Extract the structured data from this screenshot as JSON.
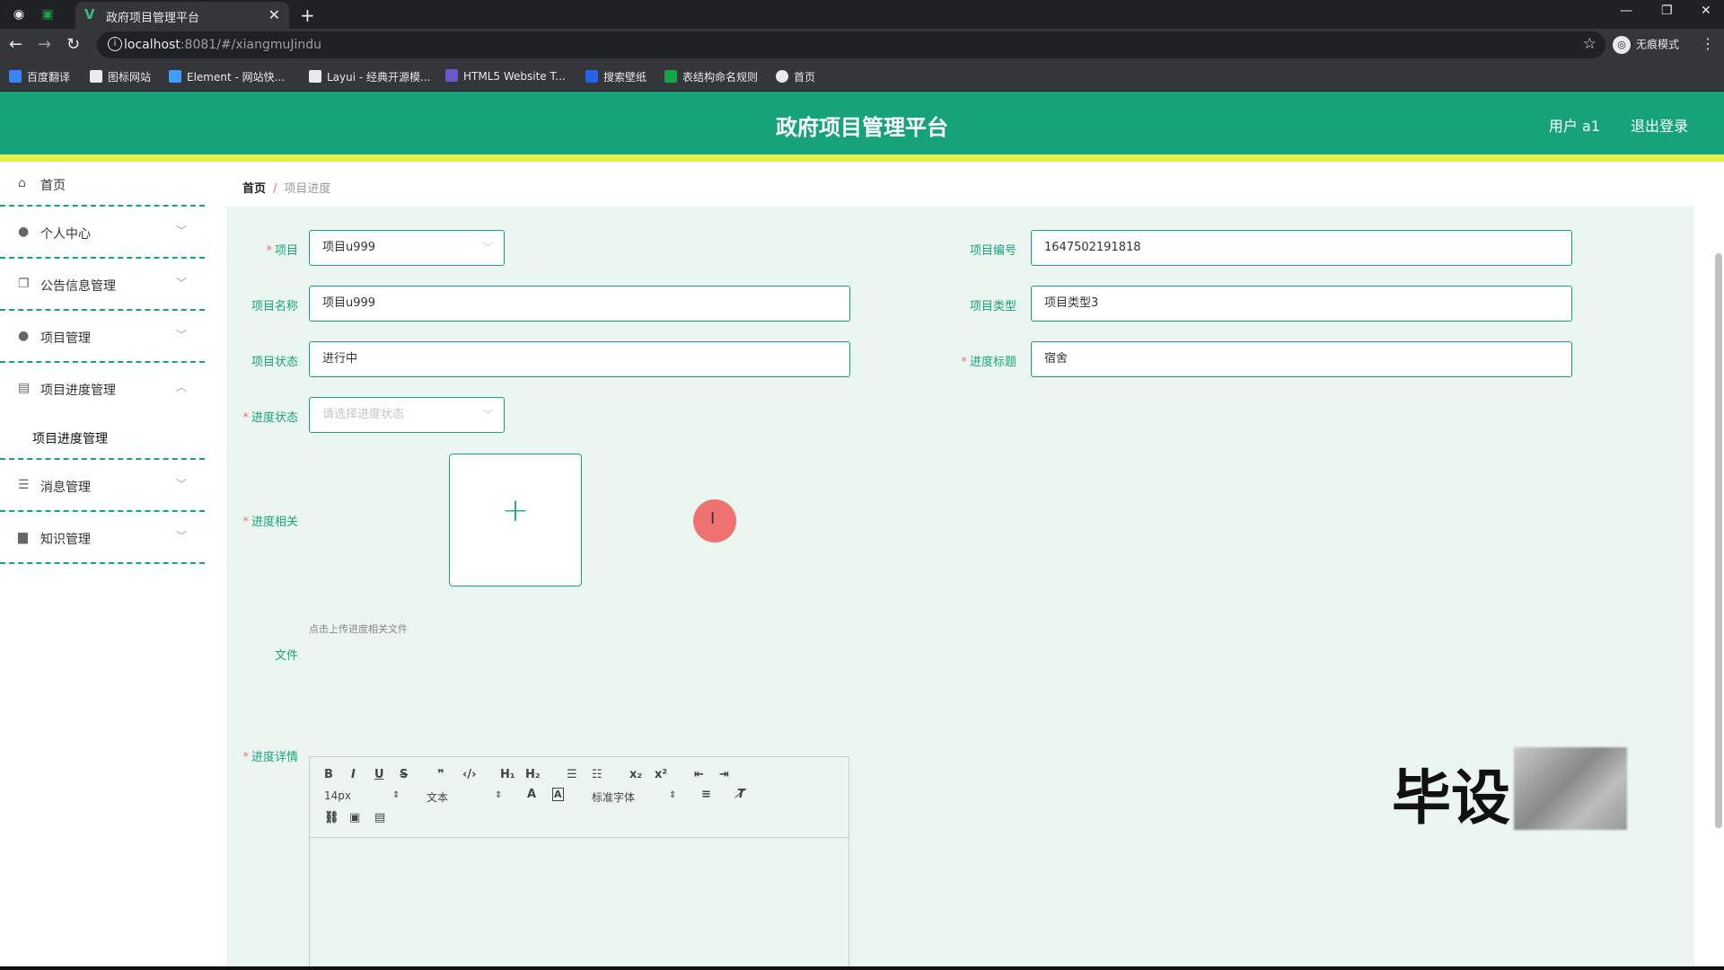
{
  "browser": {
    "tab_title": "政府项目管理平台",
    "url_host": "localhost",
    "url_rest": ":8081/#/xiangmuJindu",
    "incognito_label": "无痕模式",
    "bookmarks": [
      {
        "label": "百度翻译",
        "color": "#3b82f6"
      },
      {
        "label": "图标网站",
        "color": "#e8eaed"
      },
      {
        "label": "Element - 网站快...",
        "color": "#409eff"
      },
      {
        "label": "Layui - 经典开源模...",
        "color": "#e8eaed"
      },
      {
        "label": "HTML5 Website T...",
        "color": "#6a5acd"
      },
      {
        "label": "搜索壁纸",
        "color": "#2563eb"
      },
      {
        "label": "表结构命名规则",
        "color": "#16a34a"
      },
      {
        "label": "首页",
        "color": "#e8eaed"
      }
    ]
  },
  "header": {
    "title": "政府项目管理平台",
    "user": "用户 a1",
    "logout": "退出登录",
    "color": "#17a37a"
  },
  "sidebar": {
    "items": [
      {
        "label": "首页",
        "icon": "home-icon"
      },
      {
        "label": "个人中心",
        "icon": "user-icon"
      },
      {
        "label": "公告信息管理",
        "icon": "copy-icon"
      },
      {
        "label": "项目管理",
        "icon": "user-icon"
      },
      {
        "label": "项目进度管理",
        "icon": "briefcase-icon"
      },
      {
        "label": "消息管理",
        "icon": "menu-icon"
      },
      {
        "label": "知识管理",
        "icon": "chalkboard-icon"
      }
    ],
    "sub_item": "项目进度管理"
  },
  "breadcrumb": {
    "home": "首页",
    "separator": "/",
    "current": "项目进度"
  },
  "form": {
    "project_label": "项目",
    "project_value": "项目u999",
    "project_no_label": "项目编号",
    "project_no_value": "1647502191818",
    "project_name_label": "项目名称",
    "project_name_value": "项目u999",
    "project_type_label": "项目类型",
    "project_type_value": "项目类型3",
    "project_status_label": "项目状态",
    "project_status_value": "进行中",
    "progress_title_label": "进度标题",
    "progress_title_value": "宿舍",
    "progress_state_label": "进度状态",
    "progress_state_placeholder": "请选择进度状态",
    "progress_file_label": "进度相关",
    "progress_file_label2": "文件",
    "upload_hint": "点击上传进度相关文件",
    "detail_label": "进度详情"
  },
  "editor": {
    "font_size": "14px",
    "block_type": "文本",
    "font_family": "标准字体"
  },
  "watermark": "毕设"
}
